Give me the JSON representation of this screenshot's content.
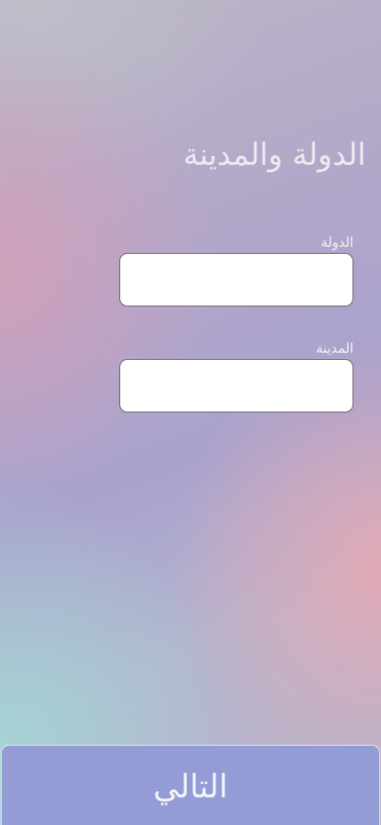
{
  "page": {
    "title": "الدولة والمدينة"
  },
  "form": {
    "country": {
      "label": "الدولة",
      "value": "",
      "placeholder": ""
    },
    "city": {
      "label": "المدينة",
      "value": "",
      "placeholder": ""
    }
  },
  "actions": {
    "next_label": "التالي"
  },
  "colors": {
    "button_background": "#949cd5",
    "title_text": "#eeeaf2",
    "input_background": "#ffffff"
  }
}
